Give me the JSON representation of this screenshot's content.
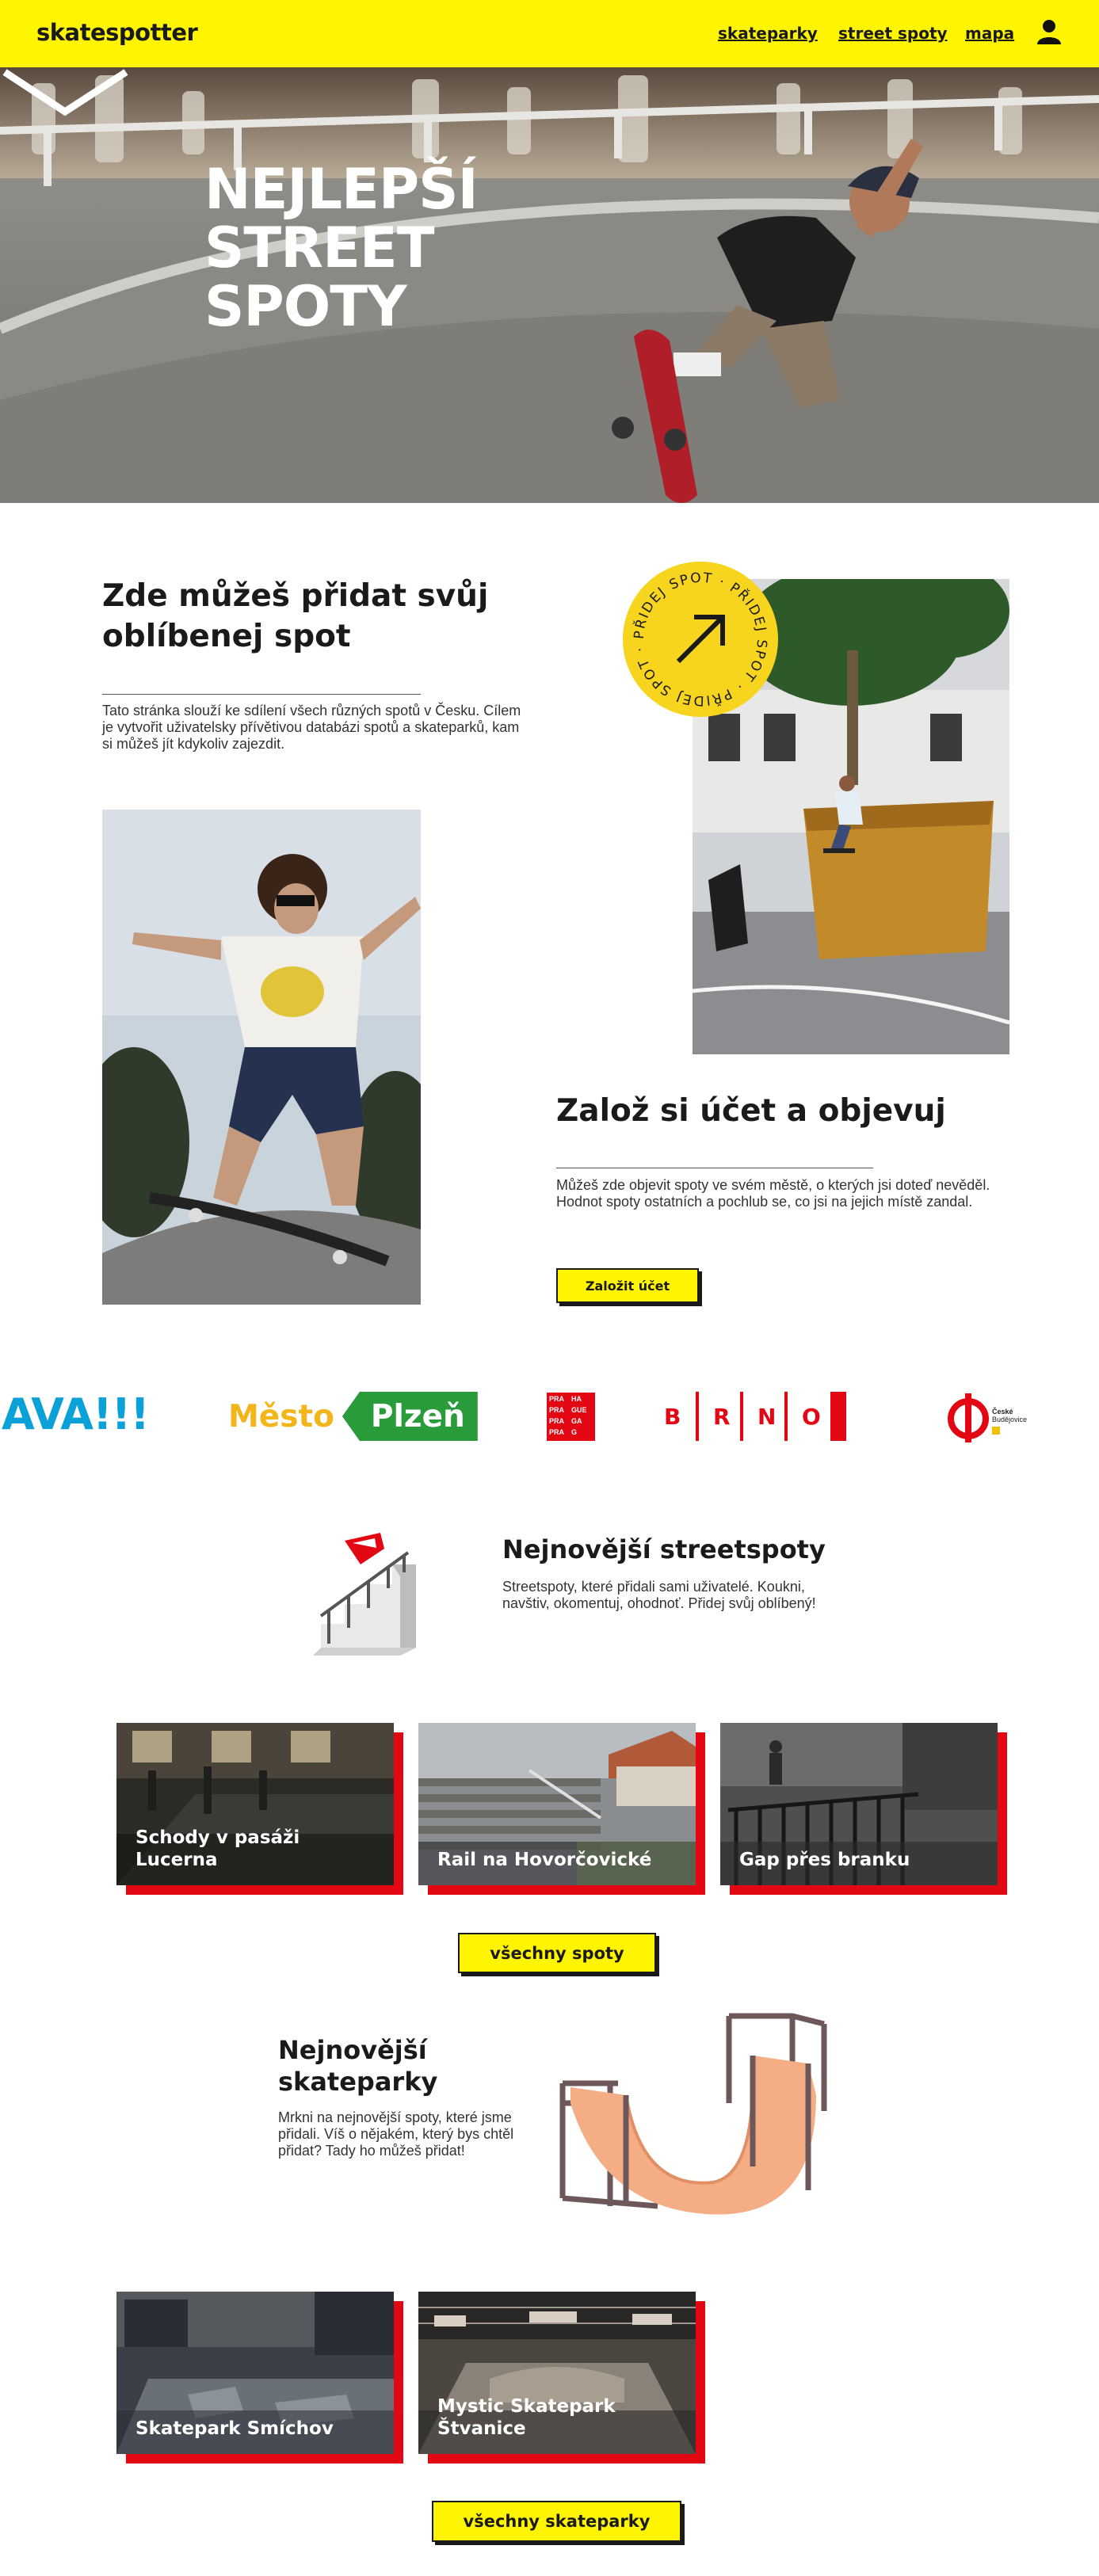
{
  "nav": {
    "brand": "skatespotter",
    "links": [
      "skateparky",
      "street spoty",
      "mapa"
    ],
    "user_icon": "user-icon"
  },
  "hero": {
    "title_lines": [
      "NEJLEPŠÍ",
      "STREET",
      "SPOTY"
    ],
    "arrow_icon": "chevron-down-icon"
  },
  "intro": {
    "title": "Zde můžeš přidat svůj oblíbenej spot",
    "text": "Tato stránka slouží ke sdílení všech různých spotů v Česku. Cílem je vytvořit uživatelsky přívětivou databázi spotů a skateparků, kam si můžeš jít kdykoliv zajezdit.",
    "badge_text": "PŘIDEJ SPOT · PŘIDEJ SPOT · PŘIDEJ SPOT ·",
    "badge_icon": "arrow-up-right-icon"
  },
  "account": {
    "title": "Založ si účet a objevuj",
    "text": "Můžeš zde objevit spoty ve svém městě, o kterých jsi doteď nevěděl. Hodnot spoty ostatních a pochlub se, co jsi na jejich místě zandal.",
    "button": "Založit účet"
  },
  "logos": {
    "ava": "AVA!!!",
    "plzen_1": "Město",
    "plzen_2": "Plzeň",
    "praha_cells": [
      "PRA",
      "HA",
      "PRA",
      "GUE",
      "PRA",
      "GA",
      "PRA",
      "G"
    ],
    "brno": [
      "B",
      "R",
      "N",
      "O"
    ],
    "cb": [
      "České",
      "Budějovice"
    ],
    "colors": {
      "ava": "#0aa0d8",
      "ava_dark": "#0b2a5b",
      "plzen_yellow": "#f2b61b",
      "plzen_green": "#2a9b3b",
      "red": "#e30613"
    }
  },
  "streetspots": {
    "title": "Nejnovější streetspoty",
    "text": "Streetspoty, které přidali sami uživatelé. Koukni, navštiv, okomentuj, ohodnoť. Přidej svůj oblíbený!",
    "illustration": "stairs-rail-icon",
    "cards": [
      {
        "label": "Schody v pasáži Lucerna"
      },
      {
        "label": "Rail na Hovorčovické"
      },
      {
        "label": "Gap přes branku"
      }
    ],
    "button": "všechny spoty"
  },
  "parks": {
    "title": "Nejnovější skateparky",
    "text": "Mrkni na nejnovější spoty, které jsme přidali. Víš o nějakém, který bys chtěl přidat? Tady ho můžeš přidat!",
    "illustration": "halfpipe-ramp-icon",
    "cards": [
      {
        "label": "Skatepark Smíchov"
      },
      {
        "label": "Mystic Skatepark Štvanice"
      }
    ],
    "button": "všechny skateparky"
  },
  "colors": {
    "accent_yellow": "#fff500",
    "accent_red": "#e30613",
    "text": "#1a1a1a"
  }
}
